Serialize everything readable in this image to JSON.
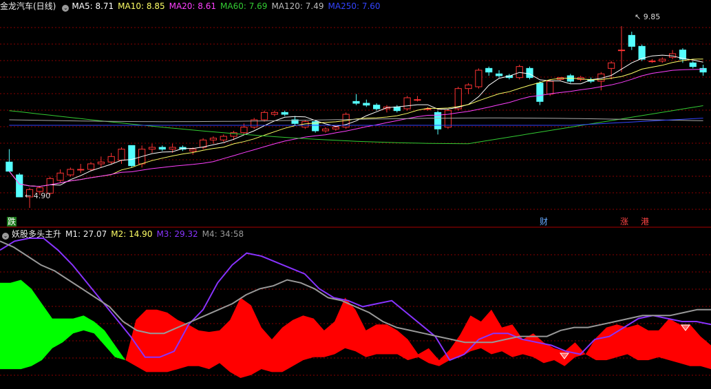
{
  "main_header": {
    "title": "金龙汽车(日线)",
    "ma5_label": "MA5:",
    "ma5_value": "8.71",
    "ma10_label": "MA10:",
    "ma10_value": "8.85",
    "ma20_label": "MA20:",
    "ma20_value": "8.61",
    "ma60_label": "MA60:",
    "ma60_value": "7.69",
    "ma120_label": "MA120:",
    "ma120_value": "7.49",
    "ma250_label": "MA250:",
    "ma250_value": "7.60"
  },
  "price_markers": {
    "high": "9.85",
    "low": "4.90"
  },
  "event_tags": {
    "fall": "跌",
    "finance": "财",
    "rise": "涨",
    "hk": "港"
  },
  "indicator_header": {
    "title": "妖股多头主升",
    "m1_label": "M1:",
    "m1_value": "27.07",
    "m2_label": "M2:",
    "m2_value": "14.90",
    "m3_label": "M3:",
    "m3_value": "29.32",
    "m4_label": "M4:",
    "m4_value": "34:58"
  },
  "colors": {
    "ma5": "#ffffff",
    "ma10": "#ffff66",
    "ma20": "#ff40ff",
    "ma60": "#33cc33",
    "ma120": "#aaaaaa",
    "ma250": "#3344ff",
    "up_candle": "#ff3333",
    "down_candle": "#55ffff",
    "grid": "#8b0000",
    "green_fill": "#00ff00",
    "red_fill": "#ff0000",
    "m3_line": "#8833ff",
    "m4_line": "#999999",
    "signal_icon": "#ff6666"
  },
  "chart_data": [
    {
      "type": "candlestick",
      "title": "金龙汽车(日线)",
      "y_range": [
        4.9,
        9.85
      ],
      "candles_ohlc": [
        [
          6.15,
          6.5,
          6.05,
          5.9
        ],
        [
          5.8,
          5.85,
          5.25,
          5.2
        ],
        [
          5.2,
          5.45,
          4.9,
          5.4
        ],
        [
          5.35,
          5.5,
          5.25,
          5.45
        ],
        [
          5.3,
          5.75,
          5.25,
          5.7
        ],
        [
          5.65,
          5.95,
          5.6,
          5.85
        ],
        [
          5.8,
          6.0,
          5.75,
          5.95
        ],
        [
          5.95,
          6.1,
          5.85,
          5.95
        ],
        [
          5.95,
          6.15,
          5.9,
          6.1
        ],
        [
          6.1,
          6.3,
          6.0,
          6.15
        ],
        [
          6.15,
          6.4,
          6.1,
          6.3
        ],
        [
          6.2,
          6.55,
          6.1,
          6.5
        ],
        [
          6.6,
          6.6,
          6.0,
          6.05
        ],
        [
          6.1,
          6.6,
          6.0,
          6.5
        ],
        [
          6.5,
          6.65,
          6.4,
          6.55
        ],
        [
          6.55,
          6.6,
          6.45,
          6.5
        ],
        [
          6.5,
          6.65,
          6.4,
          6.55
        ],
        [
          6.55,
          6.6,
          6.45,
          6.5
        ],
        [
          6.45,
          6.55,
          6.35,
          6.5
        ],
        [
          6.55,
          6.8,
          6.5,
          6.75
        ],
        [
          6.75,
          6.85,
          6.65,
          6.8
        ],
        [
          6.75,
          6.9,
          6.7,
          6.85
        ],
        [
          6.85,
          7.0,
          6.75,
          6.95
        ],
        [
          6.95,
          7.2,
          6.9,
          7.1
        ],
        [
          7.1,
          7.35,
          7.05,
          7.3
        ],
        [
          7.3,
          7.55,
          7.25,
          7.5
        ],
        [
          7.45,
          7.55,
          7.4,
          7.5
        ],
        [
          7.5,
          7.55,
          7.4,
          7.45
        ],
        [
          7.3,
          7.4,
          7.15,
          7.2
        ],
        [
          7.1,
          7.3,
          7.05,
          7.25
        ],
        [
          7.25,
          7.3,
          6.95,
          7.0
        ],
        [
          7.0,
          7.1,
          6.95,
          7.05
        ],
        [
          7.05,
          7.15,
          7.0,
          7.1
        ],
        [
          7.1,
          7.5,
          7.05,
          7.45
        ],
        [
          7.8,
          8.0,
          7.7,
          7.75
        ],
        [
          7.75,
          7.85,
          7.65,
          7.7
        ],
        [
          7.7,
          7.75,
          7.55,
          7.6
        ],
        [
          7.6,
          7.7,
          7.5,
          7.65
        ],
        [
          7.65,
          7.7,
          7.5,
          7.55
        ],
        [
          7.6,
          7.95,
          7.55,
          7.9
        ],
        [
          7.85,
          7.95,
          7.8,
          7.85
        ],
        [
          7.6,
          7.65,
          7.55,
          7.6
        ],
        [
          7.5,
          7.55,
          6.9,
          7.05
        ],
        [
          7.1,
          7.6,
          7.05,
          7.55
        ],
        [
          7.6,
          8.2,
          7.55,
          8.15
        ],
        [
          8.15,
          8.3,
          8.0,
          8.25
        ],
        [
          8.2,
          8.7,
          8.15,
          8.65
        ],
        [
          8.7,
          8.75,
          8.5,
          8.6
        ],
        [
          8.55,
          8.65,
          8.45,
          8.5
        ],
        [
          8.5,
          8.55,
          8.4,
          8.45
        ],
        [
          8.45,
          8.8,
          8.4,
          8.75
        ],
        [
          8.7,
          8.75,
          8.4,
          8.45
        ],
        [
          8.3,
          8.35,
          7.7,
          7.8
        ],
        [
          8.0,
          8.4,
          7.95,
          8.35
        ],
        [
          8.4,
          8.45,
          8.35,
          8.45
        ],
        [
          8.5,
          8.55,
          8.3,
          8.35
        ],
        [
          8.4,
          8.5,
          8.35,
          8.45
        ],
        [
          8.4,
          8.45,
          8.3,
          8.35
        ],
        [
          8.35,
          8.6,
          8.1,
          8.55
        ],
        [
          8.7,
          8.9,
          8.4,
          8.85
        ],
        [
          9.2,
          9.85,
          8.6,
          9.2
        ],
        [
          9.6,
          9.7,
          9.2,
          9.3
        ],
        [
          9.3,
          9.35,
          8.9,
          8.95
        ],
        [
          8.9,
          8.95,
          8.85,
          8.9
        ],
        [
          8.9,
          9.0,
          8.85,
          8.95
        ],
        [
          9.0,
          9.2,
          8.95,
          9.1
        ],
        [
          9.2,
          9.25,
          8.85,
          8.95
        ],
        [
          8.85,
          8.9,
          8.7,
          8.75
        ],
        [
          8.7,
          8.8,
          8.5,
          8.6
        ]
      ],
      "series": [
        {
          "name": "MA5",
          "values": "derived"
        },
        {
          "name": "MA10"
        },
        {
          "name": "MA20"
        },
        {
          "name": "MA60"
        },
        {
          "name": "MA120"
        },
        {
          "name": "MA250"
        }
      ]
    },
    {
      "type": "area",
      "title": "妖股多头主升",
      "y_range": [
        0,
        100
      ],
      "green_area": {
        "x": [
          0,
          1,
          2,
          3,
          4,
          5,
          6,
          7,
          8,
          9,
          10,
          11,
          12
        ],
        "top": [
          70,
          70,
          72,
          66,
          56,
          46,
          46,
          46,
          48,
          44,
          38,
          28,
          18
        ],
        "bottom": [
          12,
          12,
          12,
          14,
          18,
          26,
          30,
          36,
          38,
          36,
          28,
          20,
          18
        ]
      },
      "red_area": {
        "x": [
          12,
          13,
          14,
          15,
          16,
          17,
          18,
          19,
          20,
          21,
          22,
          23,
          24,
          25,
          26,
          27,
          28,
          29,
          30,
          31,
          32,
          33,
          34,
          35,
          36,
          37,
          38,
          39,
          40,
          41,
          42,
          43,
          44,
          45,
          46,
          47,
          48,
          49,
          50,
          51,
          52,
          53,
          54,
          55,
          56,
          57,
          58,
          59,
          60,
          61,
          62,
          63,
          64,
          65,
          66,
          67,
          68
        ],
        "top": [
          18,
          45,
          52,
          52,
          50,
          45,
          42,
          38,
          37,
          38,
          45,
          60,
          55,
          40,
          32,
          40,
          45,
          48,
          46,
          38,
          44,
          60,
          52,
          38,
          42,
          42,
          38,
          32,
          22,
          26,
          18,
          25,
          35,
          48,
          44,
          52,
          40,
          42,
          32,
          36,
          30,
          26,
          24,
          30,
          22,
          33,
          40,
          42,
          40,
          42,
          38,
          38,
          46,
          42,
          42,
          34,
          28
        ],
        "bottom": [
          18,
          14,
          10,
          10,
          10,
          12,
          14,
          14,
          12,
          16,
          10,
          6,
          8,
          12,
          10,
          10,
          14,
          18,
          20,
          20,
          22,
          26,
          24,
          20,
          22,
          22,
          22,
          18,
          20,
          16,
          14,
          18,
          20,
          24,
          26,
          22,
          24,
          20,
          22,
          20,
          16,
          18,
          14,
          20,
          22,
          18,
          18,
          20,
          22,
          18,
          18,
          20,
          18,
          16,
          14,
          14,
          12
        ]
      },
      "series": [
        {
          "name": "M3",
          "values": [
            92,
            98,
            100,
            100,
            92,
            82,
            70,
            58,
            46,
            34,
            20,
            20,
            24,
            42,
            52,
            70,
            82,
            90,
            88,
            84,
            80,
            76,
            66,
            60,
            58,
            54,
            56,
            58,
            50,
            42,
            34,
            18,
            22,
            32,
            36,
            36,
            32,
            30,
            28,
            24,
            22,
            32,
            34,
            40,
            46,
            48,
            46,
            44,
            44,
            42
          ]
        },
        {
          "name": "M4",
          "values": [
            98,
            94,
            88,
            82,
            78,
            72,
            66,
            60,
            54,
            44,
            38,
            36,
            36,
            40,
            44,
            48,
            52,
            56,
            62,
            66,
            68,
            72,
            70,
            66,
            60,
            58,
            54,
            50,
            44,
            40,
            38,
            36,
            34,
            32,
            30,
            30,
            30,
            32,
            34,
            34,
            34,
            38,
            40,
            40,
            42,
            44,
            46,
            48,
            48,
            48,
            50,
            52,
            52
          ]
        }
      ],
      "signals": [
        "diamond",
        "diamond"
      ]
    }
  ]
}
